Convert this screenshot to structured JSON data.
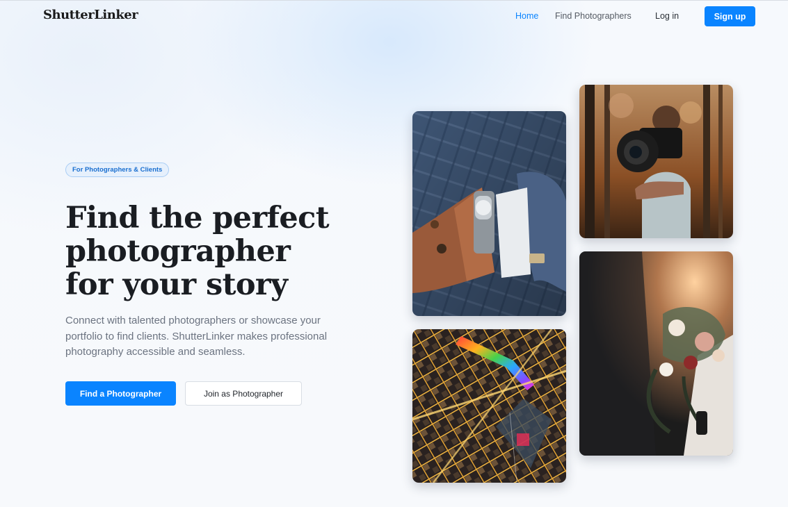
{
  "header": {
    "logo": "ShutterLinker",
    "nav": {
      "home": "Home",
      "find_photographers": "Find Photographers",
      "login": "Log in",
      "signup": "Sign up"
    }
  },
  "hero": {
    "badge": "For Photographers & Clients",
    "title_lines": [
      "Find the perfect",
      "photographer",
      "for your story"
    ],
    "description": "Connect with talented photographers or showcase your portfolio to find clients. ShutterLinker makes professional photography accessible and seamless.",
    "primary_button": "Find a Photographer",
    "secondary_button": "Join as Photographer"
  },
  "gallery": {
    "photos": [
      {
        "subject": "wrist watch with cufflink"
      },
      {
        "subject": "photographer tossing camera in autumn forest"
      },
      {
        "subject": "aerial night city with rainbow-lit building"
      },
      {
        "subject": "wedding bouquet with warm light"
      }
    ]
  },
  "colors": {
    "accent": "#0a84ff",
    "background": "#f7f9fc",
    "text": "#1a1d22",
    "muted": "#6b7380"
  }
}
